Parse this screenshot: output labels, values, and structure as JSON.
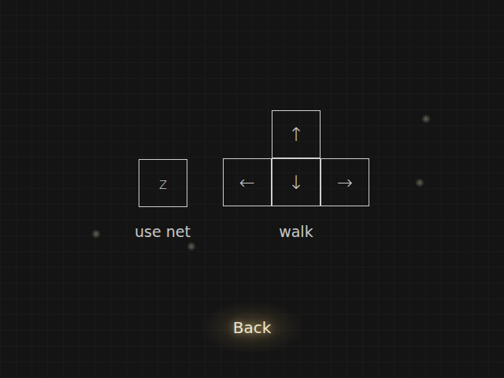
{
  "controls": [
    {
      "label": "use net",
      "keys": [
        {
          "label": "z"
        }
      ]
    },
    {
      "label": "walk",
      "keys": [
        {
          "label": "↑"
        },
        {
          "label": "←"
        },
        {
          "label": "↓"
        },
        {
          "label": "→"
        }
      ]
    }
  ],
  "buttons": [
    {
      "label": "Back",
      "selected": true
    }
  ]
}
